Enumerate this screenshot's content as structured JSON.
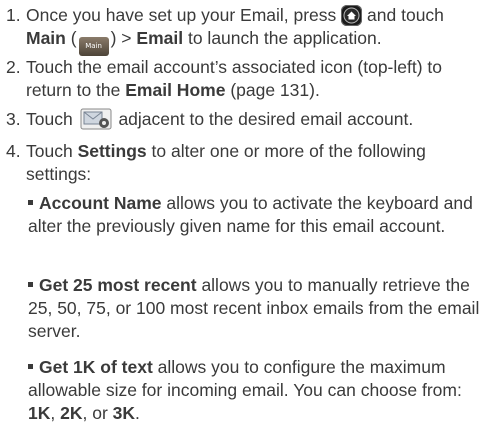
{
  "steps": [
    {
      "num": "1.",
      "a": "Once you have set up your Email, press",
      "b": "and touch",
      "c": "Main",
      "d": "(",
      "e": ")",
      "f": ">",
      "g": "Email",
      "h": "to launch the application.",
      "main_icon_text": "Main"
    },
    {
      "num": "2.",
      "a": "Touch the email account’s associated icon (top-left) to return to the",
      "b": "Email Home",
      "c": "(page 131)."
    },
    {
      "num": "3.",
      "a": "Touch",
      "b": "adjacent to the desired email account."
    },
    {
      "num": "4.",
      "a": "Touch",
      "b": "Settings",
      "c": "to alter one or more of the following settings:"
    }
  ],
  "settings": [
    {
      "name": "Account Name",
      "desc": "allows you to activate the keyboard and alter the previously given name for this email account."
    },
    {
      "name": "Get 25 most recent",
      "desc": "allows you to manually retrieve the 25, 50, 75, or 100 most recent inbox emails from the email server."
    },
    {
      "name": "Get 1K of text",
      "desc": "allows you to configure the maximum allowable size for incoming email. You can choose from:",
      "opt1": "1K",
      "opt2": "2K",
      "opt3": "3K",
      "sep1": ",",
      "sep2": ", or",
      "end": "."
    }
  ],
  "icons": {
    "home": "home-key-icon",
    "main": "main-menu-icon",
    "mail_settings": "email-settings-icon"
  }
}
